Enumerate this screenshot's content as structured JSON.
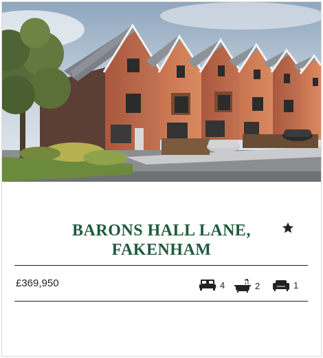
{
  "listing": {
    "title_line1": "BARONS HALL LANE,",
    "title_line2": "FAKENHAM",
    "price": "£369,950",
    "bedrooms": "4",
    "bathrooms": "2",
    "reception_rooms": "1",
    "favourite_icon": "star-icon"
  },
  "colors": {
    "title": "#1f5a3e",
    "divider": "#222222",
    "brick": "#b8664a",
    "roof": "#8a8f96"
  }
}
